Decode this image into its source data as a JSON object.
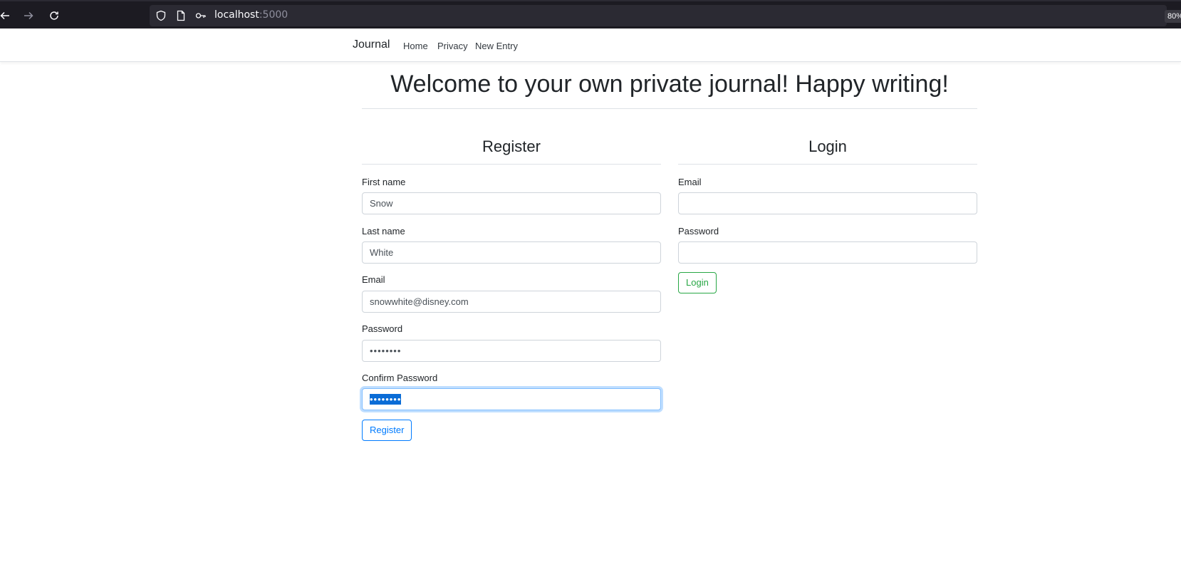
{
  "browser": {
    "url_host": "localhost",
    "url_port": ":5000",
    "zoom": "80%"
  },
  "navbar": {
    "brand": "Journal",
    "links": [
      "Home",
      "Privacy",
      "New Entry"
    ]
  },
  "main": {
    "title": "Welcome to your own private journal! Happy writing!"
  },
  "register": {
    "heading": "Register",
    "fields": [
      {
        "label": "First name",
        "value": "Snow"
      },
      {
        "label": "Last name",
        "value": "White"
      },
      {
        "label": "Email",
        "value": "snowwhite@disney.com"
      },
      {
        "label": "Password",
        "value": "••••••••"
      },
      {
        "label": "Confirm Password",
        "value": "••••••••"
      }
    ],
    "button": "Register"
  },
  "login": {
    "heading": "Login",
    "fields": [
      {
        "label": "Email",
        "value": ""
      },
      {
        "label": "Password",
        "value": ""
      }
    ],
    "button": "Login"
  },
  "colors": {
    "register_accent": "#007bff",
    "login_accent": "#28a745",
    "browser_chrome": "#1c1b22"
  },
  "icons": [
    "back-arrow-icon",
    "forward-arrow-icon",
    "reload-icon",
    "shield-icon",
    "page-icon",
    "key-icon"
  ]
}
